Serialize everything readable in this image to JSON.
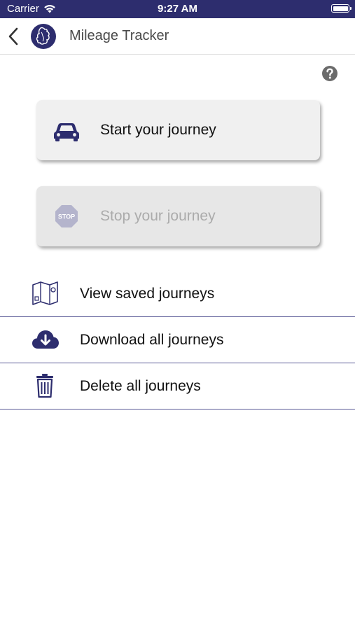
{
  "status_bar": {
    "carrier": "Carrier",
    "time": "9:27 AM"
  },
  "nav": {
    "title": "Mileage Tracker",
    "back_icon": "chevron-left-icon",
    "logo_icon": "app-logo"
  },
  "help": {
    "icon": "question-circle-icon"
  },
  "journey_buttons": {
    "start": {
      "label": "Start your journey",
      "icon": "car-icon",
      "enabled": true
    },
    "stop": {
      "label": "Stop your journey",
      "icon": "stop-sign-icon",
      "enabled": false
    }
  },
  "menu": [
    {
      "label": "View saved journeys",
      "icon": "map-icon"
    },
    {
      "label": "Download all journeys",
      "icon": "cloud-download-icon"
    },
    {
      "label": "Delete all journeys",
      "icon": "trash-icon"
    }
  ],
  "colors": {
    "brand": "#2d2d6e",
    "divider": "#5a5a96",
    "disabled_text": "#ababab"
  }
}
